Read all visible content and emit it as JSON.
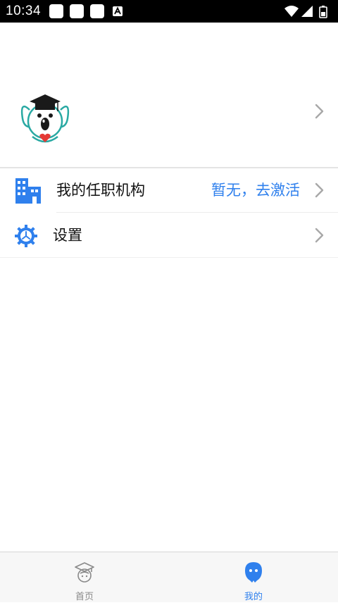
{
  "status_bar": {
    "time": "10:34",
    "icons": [
      "notification-square-icon",
      "notification-square-icon",
      "notification-square-icon",
      "a-notification-icon",
      "wifi-icon",
      "signal-icon",
      "battery-icon"
    ]
  },
  "profile": {
    "avatar_icon": "koala-graduate-avatar",
    "chevron_icon": "chevron-right-icon"
  },
  "menu": {
    "items": [
      {
        "icon": "building-icon",
        "label": "我的任职机构",
        "value": "暂无，去激活"
      },
      {
        "icon": "gear-icon",
        "label": "设置",
        "value": ""
      }
    ]
  },
  "bottom_nav": {
    "items": [
      {
        "icon": "graduation-cap-icon",
        "label": "首页",
        "active": false
      },
      {
        "icon": "user-ghost-icon",
        "label": "我的",
        "active": true
      }
    ]
  },
  "colors": {
    "accent": "#2f80ed",
    "inactive": "#8a8a8a",
    "status_bar": "#000000",
    "nav_bg": "#f7f7f7"
  }
}
